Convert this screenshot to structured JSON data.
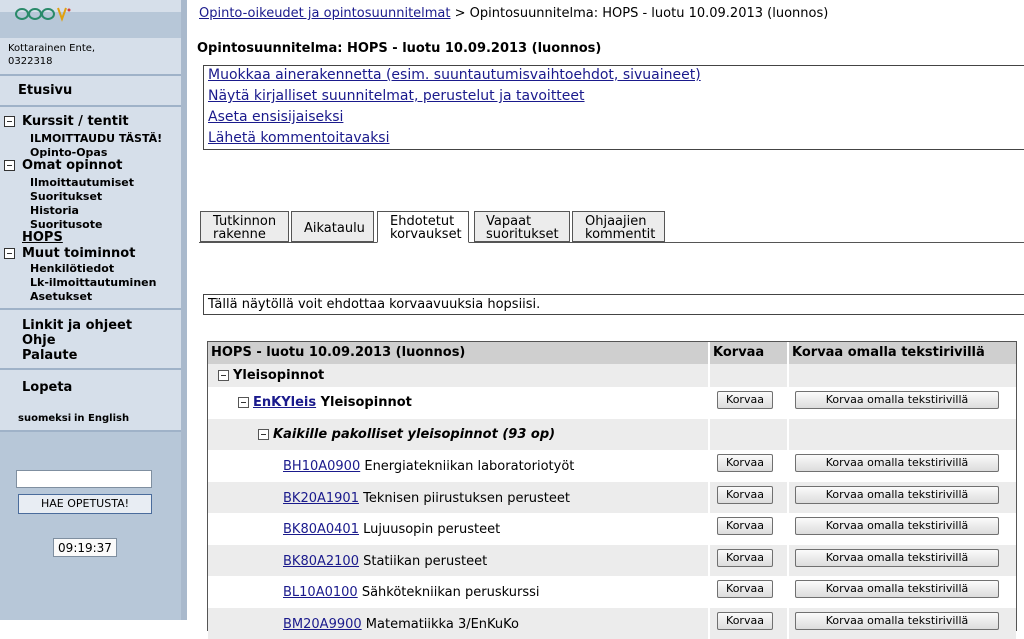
{
  "sidebar": {
    "user_name": "Kottarainen Ente,",
    "user_id": "0322318",
    "etusivu": "Etusivu",
    "courses_section": "Kurssit / tentit",
    "courses_items": [
      "ILMOITTAUDU TÄSTÄ!",
      "Opinto-Opas"
    ],
    "own_section": "Omat opinnot",
    "own_items": [
      "Ilmoittautumiset",
      "Suoritukset",
      "Historia",
      "Suoritusote"
    ],
    "hops": "HOPS",
    "other_section": "Muut toiminnot",
    "other_items": [
      "Henkilötiedot",
      "Lk-ilmoittautuminen",
      "Asetukset"
    ],
    "links": "Linkit ja ohjeet",
    "ohje": "Ohje",
    "palaute": "Palaute",
    "lopeta": "Lopeta",
    "lang_fi": "suomeksi",
    "lang_en": "in English",
    "search_button": "HAE OPETUSTA!",
    "clock": "09:19:37"
  },
  "breadcrumb": {
    "link": "Opinto-oikeudet ja opintosuunnitelmat",
    "current": " > Opintosuunnitelma: HOPS - luotu 10.09.2013 (luonnos)"
  },
  "page_title": "Opintosuunnitelma: HOPS - luotu 10.09.2013 (luonnos)",
  "actions": [
    "Muokkaa ainerakennetta (esim. suuntautumisvaihtoehdot, sivuaineet)",
    "Näytä kirjalliset suunnitelmat, perustelut ja tavoitteet",
    "Aseta ensisijaiseksi",
    "Lähetä kommentoitavaksi"
  ],
  "tabs": [
    {
      "line1": "Tutkinnon",
      "line2": "rakenne"
    },
    {
      "line1": "Aikataulu",
      "line2": ""
    },
    {
      "line1": "Ehdotetut",
      "line2": "korvaukset",
      "active": true
    },
    {
      "line1": "Vapaat",
      "line2": "suoritukset"
    },
    {
      "line1": "Ohjaajien",
      "line2": "kommentit"
    }
  ],
  "info_text": "Tällä näytöllä voit ehdottaa korvaavuuksia hopsiisi.",
  "table": {
    "headers": [
      "HOPS - luotu 10.09.2013 (luonnos)",
      "Korvaa",
      "Korvaa omalla tekstirivillä"
    ],
    "group1": "Yleisopinnot",
    "group2_code": "EnKYleis",
    "group2_name": " Yleisopinnot",
    "group3": "Kaikille pakolliset yleisopinnot (93 op)",
    "btn_korvaa": "Korvaa",
    "btn_korvaa_oma": "Korvaa omalla tekstirivillä",
    "courses": [
      {
        "code": "BH10A0900",
        "name": " Energiatekniikan laboratoriotyöt"
      },
      {
        "code": "BK20A1901",
        "name": " Teknisen piirustuksen perusteet"
      },
      {
        "code": "BK80A0401",
        "name": " Lujuusopin perusteet"
      },
      {
        "code": "BK80A2100",
        "name": " Statiikan perusteet"
      },
      {
        "code": "BL10A0100",
        "name": " Sähkötekniikan peruskurssi"
      },
      {
        "code": "BM20A9900",
        "name": " Matematiikka 3/EnKuKo"
      }
    ]
  },
  "colors": {
    "sidebar": "#b7c7d8",
    "sidebar_light": "#d6dfea",
    "link": "#1a1a8c",
    "header": "#cfcfcf",
    "row_alt": "#ececec"
  }
}
